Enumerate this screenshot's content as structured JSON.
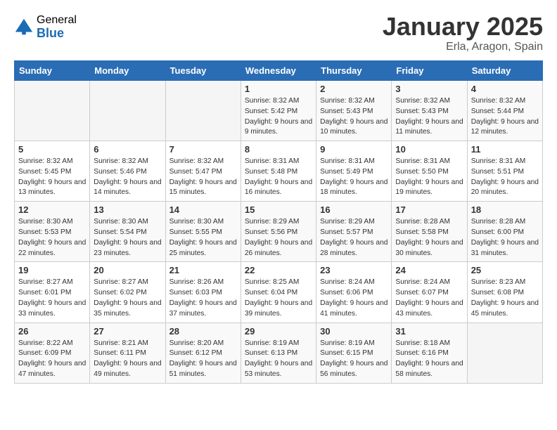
{
  "logo": {
    "general": "General",
    "blue": "Blue"
  },
  "title": "January 2025",
  "location": "Erla, Aragon, Spain",
  "days_of_week": [
    "Sunday",
    "Monday",
    "Tuesday",
    "Wednesday",
    "Thursday",
    "Friday",
    "Saturday"
  ],
  "weeks": [
    [
      {
        "day": "",
        "sunrise": "",
        "sunset": "",
        "daylight": ""
      },
      {
        "day": "",
        "sunrise": "",
        "sunset": "",
        "daylight": ""
      },
      {
        "day": "",
        "sunrise": "",
        "sunset": "",
        "daylight": ""
      },
      {
        "day": "1",
        "sunrise": "Sunrise: 8:32 AM",
        "sunset": "Sunset: 5:42 PM",
        "daylight": "Daylight: 9 hours and 9 minutes."
      },
      {
        "day": "2",
        "sunrise": "Sunrise: 8:32 AM",
        "sunset": "Sunset: 5:43 PM",
        "daylight": "Daylight: 9 hours and 10 minutes."
      },
      {
        "day": "3",
        "sunrise": "Sunrise: 8:32 AM",
        "sunset": "Sunset: 5:43 PM",
        "daylight": "Daylight: 9 hours and 11 minutes."
      },
      {
        "day": "4",
        "sunrise": "Sunrise: 8:32 AM",
        "sunset": "Sunset: 5:44 PM",
        "daylight": "Daylight: 9 hours and 12 minutes."
      }
    ],
    [
      {
        "day": "5",
        "sunrise": "Sunrise: 8:32 AM",
        "sunset": "Sunset: 5:45 PM",
        "daylight": "Daylight: 9 hours and 13 minutes."
      },
      {
        "day": "6",
        "sunrise": "Sunrise: 8:32 AM",
        "sunset": "Sunset: 5:46 PM",
        "daylight": "Daylight: 9 hours and 14 minutes."
      },
      {
        "day": "7",
        "sunrise": "Sunrise: 8:32 AM",
        "sunset": "Sunset: 5:47 PM",
        "daylight": "Daylight: 9 hours and 15 minutes."
      },
      {
        "day": "8",
        "sunrise": "Sunrise: 8:31 AM",
        "sunset": "Sunset: 5:48 PM",
        "daylight": "Daylight: 9 hours and 16 minutes."
      },
      {
        "day": "9",
        "sunrise": "Sunrise: 8:31 AM",
        "sunset": "Sunset: 5:49 PM",
        "daylight": "Daylight: 9 hours and 18 minutes."
      },
      {
        "day": "10",
        "sunrise": "Sunrise: 8:31 AM",
        "sunset": "Sunset: 5:50 PM",
        "daylight": "Daylight: 9 hours and 19 minutes."
      },
      {
        "day": "11",
        "sunrise": "Sunrise: 8:31 AM",
        "sunset": "Sunset: 5:51 PM",
        "daylight": "Daylight: 9 hours and 20 minutes."
      }
    ],
    [
      {
        "day": "12",
        "sunrise": "Sunrise: 8:30 AM",
        "sunset": "Sunset: 5:53 PM",
        "daylight": "Daylight: 9 hours and 22 minutes."
      },
      {
        "day": "13",
        "sunrise": "Sunrise: 8:30 AM",
        "sunset": "Sunset: 5:54 PM",
        "daylight": "Daylight: 9 hours and 23 minutes."
      },
      {
        "day": "14",
        "sunrise": "Sunrise: 8:30 AM",
        "sunset": "Sunset: 5:55 PM",
        "daylight": "Daylight: 9 hours and 25 minutes."
      },
      {
        "day": "15",
        "sunrise": "Sunrise: 8:29 AM",
        "sunset": "Sunset: 5:56 PM",
        "daylight": "Daylight: 9 hours and 26 minutes."
      },
      {
        "day": "16",
        "sunrise": "Sunrise: 8:29 AM",
        "sunset": "Sunset: 5:57 PM",
        "daylight": "Daylight: 9 hours and 28 minutes."
      },
      {
        "day": "17",
        "sunrise": "Sunrise: 8:28 AM",
        "sunset": "Sunset: 5:58 PM",
        "daylight": "Daylight: 9 hours and 30 minutes."
      },
      {
        "day": "18",
        "sunrise": "Sunrise: 8:28 AM",
        "sunset": "Sunset: 6:00 PM",
        "daylight": "Daylight: 9 hours and 31 minutes."
      }
    ],
    [
      {
        "day": "19",
        "sunrise": "Sunrise: 8:27 AM",
        "sunset": "Sunset: 6:01 PM",
        "daylight": "Daylight: 9 hours and 33 minutes."
      },
      {
        "day": "20",
        "sunrise": "Sunrise: 8:27 AM",
        "sunset": "Sunset: 6:02 PM",
        "daylight": "Daylight: 9 hours and 35 minutes."
      },
      {
        "day": "21",
        "sunrise": "Sunrise: 8:26 AM",
        "sunset": "Sunset: 6:03 PM",
        "daylight": "Daylight: 9 hours and 37 minutes."
      },
      {
        "day": "22",
        "sunrise": "Sunrise: 8:25 AM",
        "sunset": "Sunset: 6:04 PM",
        "daylight": "Daylight: 9 hours and 39 minutes."
      },
      {
        "day": "23",
        "sunrise": "Sunrise: 8:24 AM",
        "sunset": "Sunset: 6:06 PM",
        "daylight": "Daylight: 9 hours and 41 minutes."
      },
      {
        "day": "24",
        "sunrise": "Sunrise: 8:24 AM",
        "sunset": "Sunset: 6:07 PM",
        "daylight": "Daylight: 9 hours and 43 minutes."
      },
      {
        "day": "25",
        "sunrise": "Sunrise: 8:23 AM",
        "sunset": "Sunset: 6:08 PM",
        "daylight": "Daylight: 9 hours and 45 minutes."
      }
    ],
    [
      {
        "day": "26",
        "sunrise": "Sunrise: 8:22 AM",
        "sunset": "Sunset: 6:09 PM",
        "daylight": "Daylight: 9 hours and 47 minutes."
      },
      {
        "day": "27",
        "sunrise": "Sunrise: 8:21 AM",
        "sunset": "Sunset: 6:11 PM",
        "daylight": "Daylight: 9 hours and 49 minutes."
      },
      {
        "day": "28",
        "sunrise": "Sunrise: 8:20 AM",
        "sunset": "Sunset: 6:12 PM",
        "daylight": "Daylight: 9 hours and 51 minutes."
      },
      {
        "day": "29",
        "sunrise": "Sunrise: 8:19 AM",
        "sunset": "Sunset: 6:13 PM",
        "daylight": "Daylight: 9 hours and 53 minutes."
      },
      {
        "day": "30",
        "sunrise": "Sunrise: 8:19 AM",
        "sunset": "Sunset: 6:15 PM",
        "daylight": "Daylight: 9 hours and 56 minutes."
      },
      {
        "day": "31",
        "sunrise": "Sunrise: 8:18 AM",
        "sunset": "Sunset: 6:16 PM",
        "daylight": "Daylight: 9 hours and 58 minutes."
      },
      {
        "day": "",
        "sunrise": "",
        "sunset": "",
        "daylight": ""
      }
    ]
  ]
}
